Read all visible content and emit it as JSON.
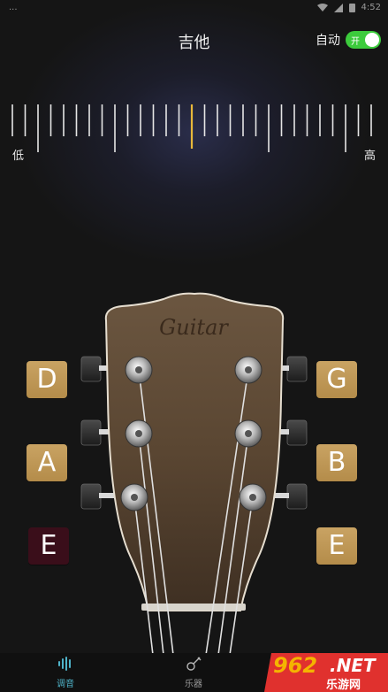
{
  "status": {
    "left": "...",
    "time": "4:52"
  },
  "header": {
    "title": "吉他",
    "auto_label": "自动",
    "toggle_text": "开"
  },
  "tuner": {
    "low_label": "低",
    "high_label": "高",
    "tick_count": 29,
    "indicator_color": "#e8b83a"
  },
  "headstock": {
    "brand": "Guitar"
  },
  "strings": {
    "left": [
      {
        "note": "D",
        "active": false
      },
      {
        "note": "A",
        "active": false
      },
      {
        "note": "E",
        "active": true
      }
    ],
    "right": [
      {
        "note": "G",
        "active": false
      },
      {
        "note": "B",
        "active": false
      },
      {
        "note": "E",
        "active": false
      }
    ]
  },
  "tabs": [
    {
      "label": "调音",
      "icon": "waveform-icon",
      "active": true
    },
    {
      "label": "乐器",
      "icon": "guitar-icon",
      "active": false
    }
  ],
  "watermark": {
    "num": "962",
    "suffix": ".NET",
    "cn": "乐游网"
  },
  "colors": {
    "accent_green": "#3ccb3c",
    "string_button": "#c9a363",
    "active_string": "#3a0e1a",
    "tab_active": "#4fb3c9"
  }
}
